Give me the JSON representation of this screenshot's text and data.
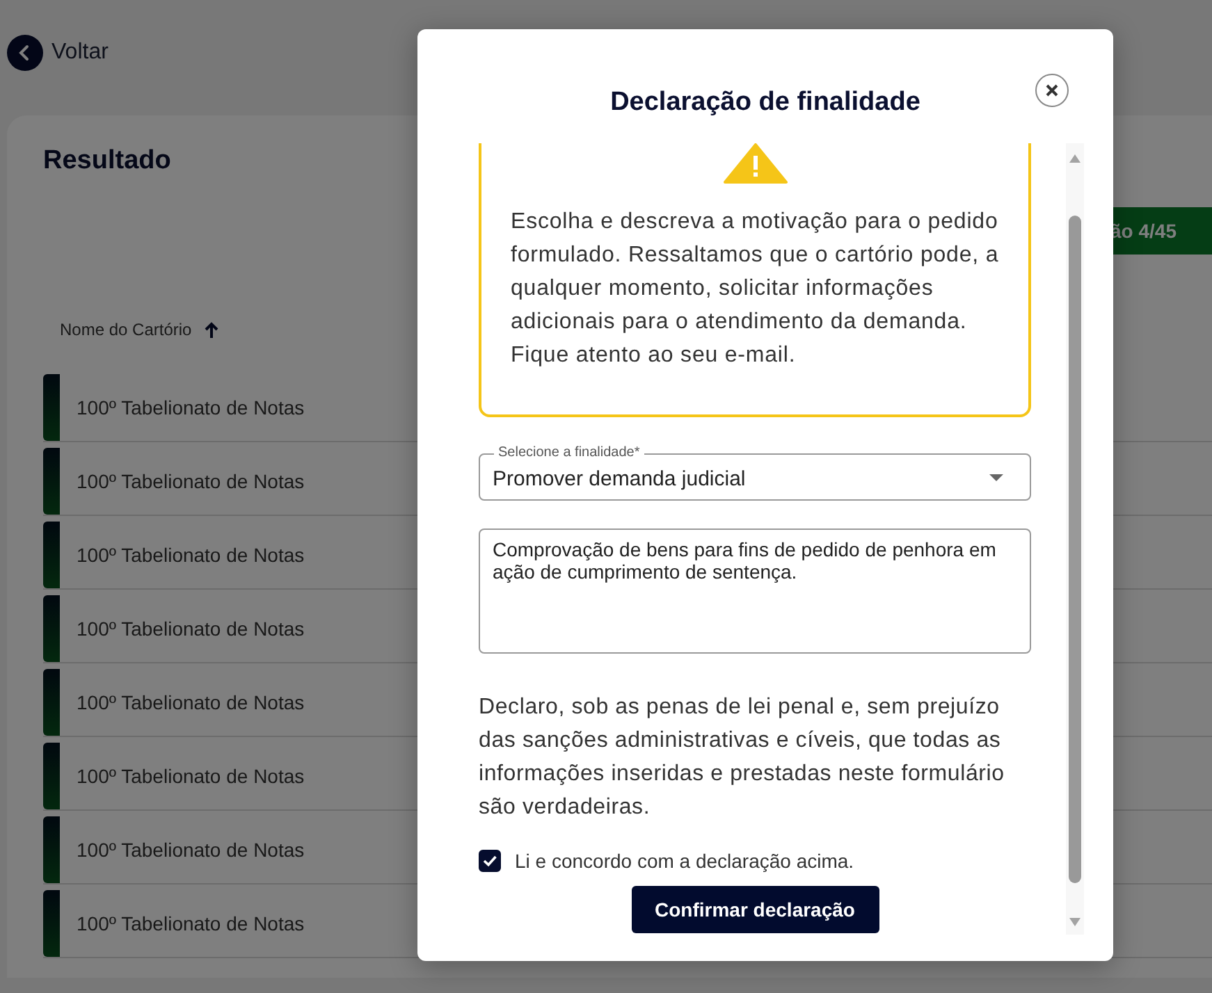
{
  "back_link": {
    "label": "Voltar"
  },
  "results": {
    "title": "Resultado",
    "action_button": "ão 4/45",
    "columns": [
      {
        "label": "Nome do Cartório",
        "sort_ascending": true
      }
    ],
    "rows": [
      {
        "name": "100º Tabelionato de Notas"
      },
      {
        "name": "100º Tabelionato de Notas"
      },
      {
        "name": "100º Tabelionato de Notas"
      },
      {
        "name": "100º Tabelionato de Notas"
      },
      {
        "name": "100º Tabelionato de Notas"
      },
      {
        "name": "100º Tabelionato de Notas"
      },
      {
        "name": "100º Tabelionato de Notas"
      },
      {
        "name": "100º Tabelionato de Notas"
      }
    ]
  },
  "modal": {
    "title": "Declaração de finalidade",
    "notice": "Escolha e descreva a motivação para o pedido formulado. Ressaltamos que o cartório pode, a qualquer momento, solicitar informações adicionais para o atendimento da demanda. Fique atento ao seu e-mail.",
    "purpose_select": {
      "label": "Selecione a finalidade*",
      "value": "Promover demanda judicial"
    },
    "details": {
      "value": "Comprovação de bens para fins de pedido de penhora em ação de cumprimento de sentença."
    },
    "declaration": "Declaro, sob as penas de lei penal e, sem prejuízo das sanções administrativas e cíveis, que todas as informações inseridas e prestadas neste formulário são verdadeiras.",
    "agreement": {
      "label": "Li e concordo com a declaração acima.",
      "checked": true
    },
    "confirm_button": "Confirmar declaração"
  }
}
